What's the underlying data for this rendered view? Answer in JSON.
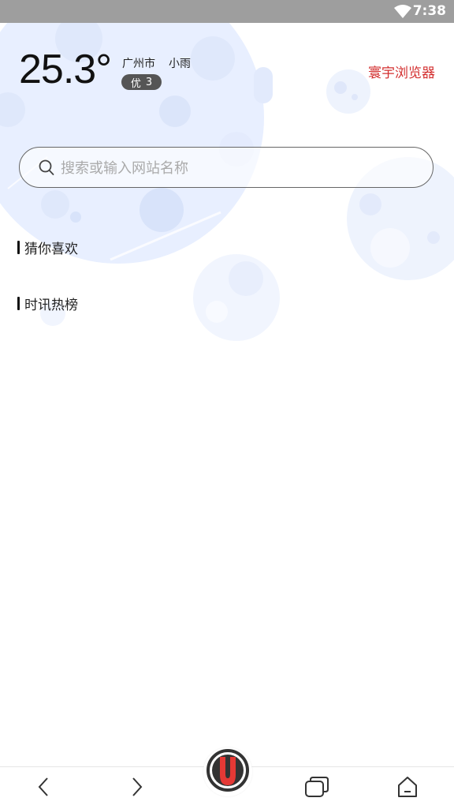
{
  "status_bar": {
    "time": "7:38"
  },
  "weather": {
    "temperature": "25.3°",
    "city": "广州市",
    "condition": "小雨",
    "aqi_label": "优",
    "aqi_value": "3"
  },
  "brand": {
    "name": "寰宇浏览器",
    "color": "#d32f2f"
  },
  "search": {
    "placeholder": "搜索或输入网站名称",
    "value": ""
  },
  "sections": [
    {
      "title": "猜你喜欢"
    },
    {
      "title": "时讯热榜"
    }
  ],
  "bottom_nav": {
    "items": [
      {
        "icon": "chevron-left-icon"
      },
      {
        "icon": "chevron-right-icon"
      },
      {
        "icon": "browser-logo-icon"
      },
      {
        "icon": "windows-icon"
      },
      {
        "icon": "home-icon"
      }
    ]
  }
}
